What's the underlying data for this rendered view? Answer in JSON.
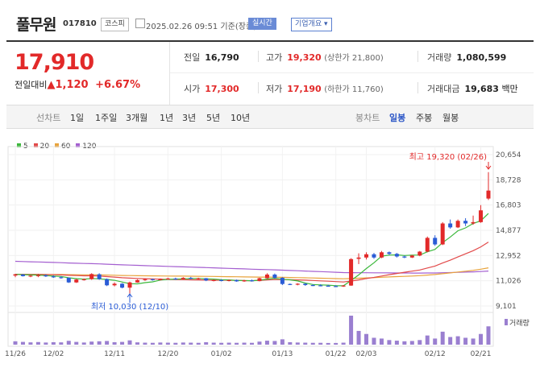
{
  "stock": {
    "name": "풀무원",
    "code": "017810",
    "market": "코스피",
    "timestamp": "2025.02.26 09:51 기준(장중)",
    "realtime_label": "실시간",
    "info_label": "기업개요",
    "price": "17,910",
    "change_label": "전일대비",
    "change_amount": "1,120",
    "change_pct": "+6.67%"
  },
  "stats": {
    "prev_label": "전일",
    "prev": "16,790",
    "high_label": "고가",
    "high": "19,320",
    "upper_limit": "(상한가 21,800)",
    "volume_label": "거래량",
    "volume": "1,080,599",
    "open_label": "시가",
    "open": "17,300",
    "low_label": "저가",
    "low": "17,190",
    "lower_limit": "(하한가 11,760)",
    "turnover_label": "거래대금",
    "turnover": "19,683",
    "turnover_unit": "백만"
  },
  "toolbar": {
    "line_chart": "선차트",
    "periods": [
      "1일",
      "1주일",
      "3개월",
      "1년",
      "3년",
      "5년",
      "10년"
    ],
    "candle_chart": "봉차트",
    "candle_periods": [
      "일봉",
      "주봉",
      "월봉"
    ]
  },
  "legend": [
    "5",
    "20",
    "60",
    "120"
  ],
  "colors": {
    "up": "#e22929",
    "down": "#2a5cd6",
    "ma5": "#3cb83c",
    "ma20": "#e24a4a",
    "ma60": "#e8a33c",
    "ma120": "#a45fd0",
    "volume": "#9a7fd0"
  },
  "chart_data": {
    "type": "candlestick",
    "y_ticks": [
      20654,
      18728,
      16803,
      14877,
      12952,
      11026,
      9101
    ],
    "ylim": [
      9101,
      20654
    ],
    "x_ticks": [
      "11/26",
      "12/02",
      "12/11",
      "12/20",
      "01/02",
      "01/13",
      "01/22",
      "02/03",
      "02/12",
      "02/21"
    ],
    "high_annotation": "최고 19,320 (02/26)",
    "low_annotation": "최저 10,030 (12/10)",
    "volume_label": "거래량",
    "candles": [
      [
        11420,
        11560,
        11300,
        11520
      ],
      [
        11500,
        11540,
        11350,
        11380
      ],
      [
        11380,
        11460,
        11300,
        11420
      ],
      [
        11420,
        11560,
        11300,
        11450
      ],
      [
        11440,
        11520,
        11320,
        11360
      ],
      [
        11360,
        11440,
        11250,
        11300
      ],
      [
        11300,
        11360,
        11180,
        11260
      ],
      [
        11260,
        11280,
        10860,
        10900
      ],
      [
        10900,
        11180,
        10860,
        11120
      ],
      [
        11100,
        11200,
        11040,
        11150
      ],
      [
        11150,
        11600,
        11100,
        11540
      ],
      [
        11520,
        11600,
        11100,
        11150
      ],
      [
        11150,
        11200,
        10620,
        10680
      ],
      [
        10680,
        10900,
        10600,
        10800
      ],
      [
        10800,
        10850,
        10450,
        10500
      ],
      [
        10500,
        10960,
        10030,
        10900
      ],
      [
        10900,
        11140,
        10880,
        11080
      ],
      [
        11080,
        11200,
        11020,
        11150
      ],
      [
        11150,
        11180,
        11040,
        11080
      ],
      [
        11080,
        11200,
        11060,
        11180
      ],
      [
        11180,
        11260,
        11120,
        11200
      ],
      [
        11200,
        11260,
        11100,
        11150
      ],
      [
        11150,
        11300,
        11120,
        11250
      ],
      [
        11250,
        11320,
        11150,
        11180
      ],
      [
        11180,
        11260,
        11120,
        11220
      ],
      [
        11220,
        11240,
        11000,
        11050
      ],
      [
        11050,
        11120,
        10980,
        11080
      ],
      [
        11080,
        11150,
        10980,
        11020
      ],
      [
        11020,
        11120,
        10980,
        11080
      ],
      [
        11080,
        11120,
        10950,
        10980
      ],
      [
        10980,
        11100,
        10950,
        11060
      ],
      [
        11060,
        11120,
        10960,
        11000
      ],
      [
        11000,
        11260,
        10980,
        11220
      ],
      [
        11220,
        11600,
        11180,
        11500
      ],
      [
        11500,
        11580,
        11200,
        11250
      ],
      [
        11250,
        11300,
        10700,
        10780
      ],
      [
        10780,
        10820,
        10700,
        10740
      ],
      [
        10740,
        10840,
        10680,
        10800
      ],
      [
        10800,
        10840,
        10640,
        10700
      ],
      [
        10700,
        10760,
        10620,
        10680
      ],
      [
        10680,
        10760,
        10600,
        10650
      ],
      [
        10650,
        10720,
        10580,
        10620
      ],
      [
        10620,
        10680,
        10560,
        10600
      ],
      [
        10600,
        10700,
        10560,
        10660
      ],
      [
        10660,
        12750,
        10640,
        12680
      ],
      [
        12700,
        13120,
        12300,
        12800
      ],
      [
        12800,
        13200,
        12650,
        13050
      ],
      [
        13050,
        13150,
        12700,
        12800
      ],
      [
        12800,
        13300,
        12750,
        13200
      ],
      [
        13200,
        13260,
        13000,
        13080
      ],
      [
        13080,
        13150,
        12800,
        12880
      ],
      [
        12880,
        12950,
        12750,
        12800
      ],
      [
        12800,
        13000,
        12760,
        12950
      ],
      [
        12950,
        13300,
        12900,
        13250
      ],
      [
        13250,
        14400,
        13200,
        14300
      ],
      [
        14300,
        14500,
        13700,
        13800
      ],
      [
        13800,
        15500,
        13750,
        15400
      ],
      [
        15400,
        15700,
        15000,
        15100
      ],
      [
        15100,
        15700,
        15050,
        15600
      ],
      [
        15600,
        15800,
        15200,
        15400
      ],
      [
        15400,
        16000,
        15300,
        15500
      ],
      [
        15500,
        16800,
        15450,
        16400
      ],
      [
        17300,
        19320,
        17190,
        17910
      ]
    ],
    "volume": [
      22,
      18,
      15,
      17,
      14,
      16,
      15,
      25,
      18,
      14,
      20,
      22,
      24,
      16,
      18,
      28,
      15,
      13,
      12,
      14,
      13,
      12,
      14,
      13,
      12,
      16,
      13,
      12,
      13,
      12,
      13,
      12,
      20,
      26,
      24,
      35,
      16,
      14,
      13,
      12,
      12,
      11,
      11,
      13,
      190,
      90,
      70,
      45,
      40,
      30,
      26,
      22,
      24,
      30,
      60,
      40,
      85,
      50,
      55,
      45,
      40,
      70,
      120
    ]
  }
}
